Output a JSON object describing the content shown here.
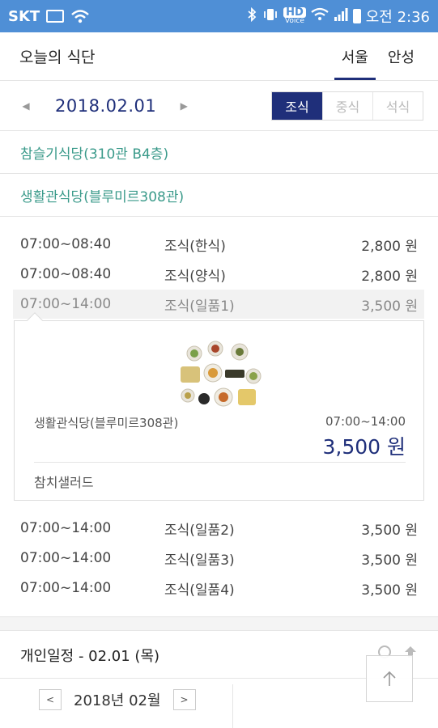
{
  "status_bar": {
    "carrier": "SKT",
    "hd_label": "HD",
    "hd_sub": "Voice",
    "time": "오전 2:36"
  },
  "header": {
    "title": "오늘의 식단",
    "tabs": [
      {
        "label": "서울",
        "active": true
      },
      {
        "label": "안성",
        "active": false
      }
    ]
  },
  "date_nav": {
    "date": "2018.02.01",
    "prev_icon": "triangle-left-icon",
    "next_icon": "triangle-right-icon",
    "meals": [
      {
        "label": "조식",
        "active": true
      },
      {
        "label": "중식",
        "active": false
      },
      {
        "label": "석식",
        "active": false
      }
    ]
  },
  "cafeterias": [
    {
      "name": "참슬기식당(310관 B4층)"
    },
    {
      "name": "생활관식당(블루미르308관)"
    }
  ],
  "menu_items": [
    {
      "time": "07:00~08:40",
      "name": "조식(한식)",
      "price": "2,800 원"
    },
    {
      "time": "07:00~08:40",
      "name": "조식(양식)",
      "price": "2,800 원"
    },
    {
      "time": "07:00~14:00",
      "name": "조식(일품1)",
      "price": "3,500 원",
      "selected": true
    },
    {
      "time": "07:00~14:00",
      "name": "조식(일품2)",
      "price": "3,500 원"
    },
    {
      "time": "07:00~14:00",
      "name": "조식(일품3)",
      "price": "3,500 원"
    },
    {
      "time": "07:00~14:00",
      "name": "조식(일품4)",
      "price": "3,500 원"
    }
  ],
  "detail": {
    "cafeteria": "생활관식당(블루미르308관)",
    "time": "07:00~14:00",
    "price": "3,500 원",
    "menu": "참치샐러드"
  },
  "schedule": {
    "title": "개인일정 - 02.01 (목)",
    "month": "2018년 02월",
    "prev_label": "<",
    "next_label": ">"
  },
  "colors": {
    "status_bar": "#4f8fd6",
    "accent": "#1f2f7a",
    "cafeteria_text": "#3a9a8a"
  }
}
